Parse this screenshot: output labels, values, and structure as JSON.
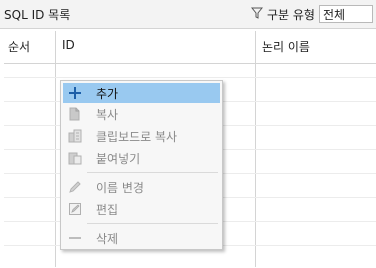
{
  "header": {
    "title": "SQL ID 목록",
    "filter_label": "구분 유형",
    "filter_value": "전체"
  },
  "table": {
    "columns": [
      "순서",
      "ID",
      "논리 이름"
    ]
  },
  "context_menu": {
    "items": [
      {
        "label": "추가",
        "icon": "plus-icon",
        "enabled": true,
        "selected": true
      },
      {
        "label": "복사",
        "icon": "copy-icon",
        "enabled": false
      },
      {
        "label": "클립보드로 복사",
        "icon": "clipboard-copy-icon",
        "enabled": false
      },
      {
        "label": "붙여넣기",
        "icon": "paste-icon",
        "enabled": false
      },
      {
        "label": "이름 변경",
        "icon": "rename-icon",
        "enabled": false
      },
      {
        "label": "편집",
        "icon": "edit-icon",
        "enabled": false
      },
      {
        "label": "삭제",
        "icon": "delete-icon",
        "enabled": false
      }
    ]
  },
  "colors": {
    "selection": "#99c9f0",
    "accent": "#1b5ea8",
    "disabled_text": "#8a8a8a"
  }
}
